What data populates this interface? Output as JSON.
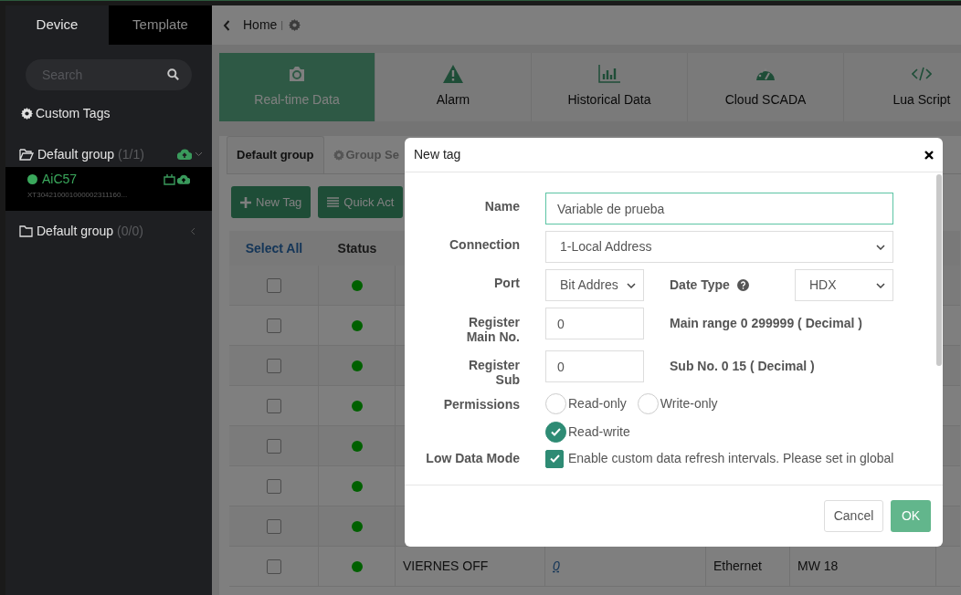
{
  "sidebar": {
    "tabs": [
      {
        "label": "Device",
        "selected": true
      },
      {
        "label": "Template",
        "selected": false
      }
    ],
    "search": {
      "placeholder": "Search"
    },
    "custom_tags": "Custom Tags",
    "groups": [
      {
        "name": "Default group",
        "count": "(1/1)",
        "expanded": true,
        "devices": [
          {
            "name": "AiC57",
            "serial": "XT304210001000002311160...",
            "online": true
          }
        ]
      },
      {
        "name": "Default group",
        "count": "(0/0)",
        "expanded": false
      }
    ]
  },
  "breadcrumb": {
    "home": "Home",
    "separator": "|"
  },
  "modules": [
    {
      "kind": "camera",
      "label": "Real-time Data",
      "selected": true
    },
    {
      "kind": "alarm",
      "label": "Alarm",
      "selected": false
    },
    {
      "kind": "chart",
      "label": "Historical Data",
      "selected": false
    },
    {
      "kind": "gauge",
      "label": "Cloud SCADA",
      "selected": false
    },
    {
      "kind": "code",
      "label": "Lua Script",
      "selected": false
    }
  ],
  "group_tabs": [
    {
      "label": "Default group",
      "selected": true
    },
    {
      "label": "Group Se",
      "selected": false
    }
  ],
  "toolbar": [
    {
      "label": "New Tag"
    },
    {
      "label": "Quick Act"
    }
  ],
  "table": {
    "columns": [
      "Select All",
      "Status"
    ],
    "rows": [
      {
        "checked": false,
        "online": true
      },
      {
        "checked": false,
        "online": true
      },
      {
        "checked": false,
        "online": true
      },
      {
        "checked": false,
        "online": true
      },
      {
        "checked": false,
        "online": true
      },
      {
        "checked": false,
        "online": true
      },
      {
        "checked": false,
        "online": true
      },
      {
        "checked": false,
        "online": true,
        "cells": [
          "VIERNES OFF",
          "0",
          "Ethernet",
          "MW 18"
        ]
      }
    ]
  },
  "dialog": {
    "title": "New tag",
    "fields": [
      {
        "kind": "text",
        "label": "Name",
        "value": "Variable de prueba",
        "focused": true
      },
      {
        "kind": "select",
        "label": "Connection",
        "value": "1-Local Address"
      },
      {
        "kind": "pair",
        "label": "Port",
        "value": "Bit Addres",
        "label2": "Date Type",
        "value2": "HDX"
      },
      {
        "kind": "number",
        "label": "Register Main No.",
        "value": "0",
        "note": "Main range 0 299999 ( Decimal )"
      },
      {
        "kind": "number",
        "label": "Register Sub",
        "value": "0",
        "note": "Sub No. 0 15 ( Decimal )"
      },
      {
        "kind": "radio",
        "label": "Permissions",
        "options": [
          {
            "label": "Read-only",
            "selected": false
          },
          {
            "label": "Write-only",
            "selected": false
          },
          {
            "label": "Read-write",
            "selected": true
          }
        ]
      },
      {
        "kind": "checkbox",
        "label": "Low Data Mode",
        "checked": true,
        "text": "Enable custom data refresh intervals. Please set in global"
      }
    ],
    "buttons": [
      {
        "kind": "cancel",
        "label": "Cancel"
      },
      {
        "kind": "ok",
        "label": "OK"
      }
    ]
  }
}
